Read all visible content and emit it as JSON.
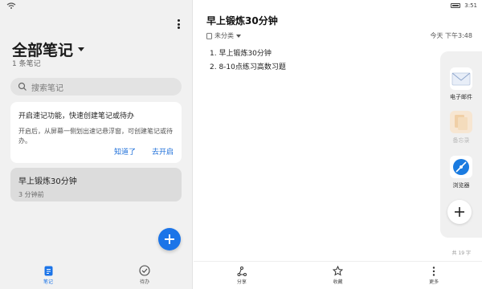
{
  "status": {
    "time": "3:51"
  },
  "left": {
    "all_notes_title": "全部笔记",
    "note_count": "1 条笔记",
    "search_placeholder": "搜索笔记",
    "tip_card": {
      "title": "开启速记功能，快速创建笔记或待办",
      "body": "开启后，从屏幕一侧划出速记悬浮窗，可创建笔记或待办。",
      "dismiss_label": "知道了",
      "enable_label": "去开启"
    },
    "notes": [
      {
        "title": "早上锻炼30分钟",
        "time": "3 分钟前"
      }
    ],
    "tabs": [
      {
        "label": "笔记",
        "icon": "note-icon",
        "active": true
      },
      {
        "label": "待办",
        "icon": "todo-check-icon",
        "active": false
      }
    ]
  },
  "editor": {
    "title": "早上锻炼30分钟",
    "category": "未分类",
    "date": "今天 下午3:48",
    "lines": [
      "1. 早上锻炼30分钟",
      "2. 8-10点练习高数习题"
    ],
    "word_count": "共 19 字"
  },
  "dock": {
    "apps": [
      {
        "label": "电子邮件",
        "icon": "email-icon",
        "enabled": true
      },
      {
        "label": "备忘录",
        "icon": "memo-icon",
        "enabled": false
      },
      {
        "label": "浏览器",
        "icon": "browser-icon",
        "enabled": true
      }
    ]
  },
  "toolbar": [
    {
      "label": "分享",
      "icon": "share-icon"
    },
    {
      "label": "收藏",
      "icon": "star-icon"
    },
    {
      "label": "更多",
      "icon": "more-icon"
    }
  ],
  "colors": {
    "accent": "#1b74e8",
    "link": "#1e6fd9",
    "left_bg": "#f1f1f1"
  }
}
